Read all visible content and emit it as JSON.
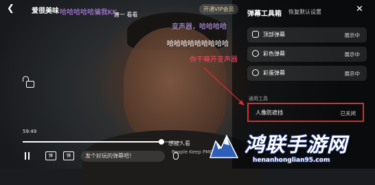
{
  "header": {
    "title": "爱很美味",
    "vip_label": "开通VIP会员"
  },
  "danmaku": [
    "哈哈哈哈哈骗我KK",
    "唐一 看看",
    "变声器，哈哈哈哈",
    "哈哈哈哈哈哈哈哈哈",
    "你干嘛开变声器",
    "想被人看",
    "People Keep PMO"
  ],
  "player": {
    "current_time": "59:49",
    "progress_fraction": 0.87,
    "input_placeholder": "发个好玩的弹幕吧！"
  },
  "panel": {
    "title": "弹幕工具箱",
    "reset_label": "恢复默认设置",
    "rows": [
      {
        "label": "顶部弹幕",
        "status": "展示中",
        "icon": "top-danmaku-icon"
      },
      {
        "label": "彩色弹幕",
        "status": "展示中",
        "icon": "color-danmaku-icon"
      },
      {
        "label": "彩蛋弹幕",
        "status": "展示中",
        "icon": "egg-danmaku-icon"
      }
    ],
    "section_label": "通用工具",
    "portrait": {
      "label": "人像防遮挡",
      "status": "已关闭"
    }
  },
  "watermark": {
    "cn": "鸿联手游网",
    "url": "henanhonglian95.com"
  },
  "colors": {
    "highlight_border": "#e02a2a",
    "danmaku_purple": "#c58bff",
    "danmaku_red": "#ff4a68",
    "vip_gold": "#e0c98a"
  }
}
